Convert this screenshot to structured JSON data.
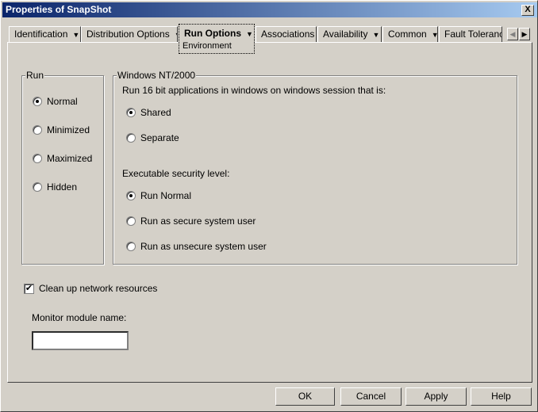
{
  "title": "Properties of SnapShot",
  "close_label": "X",
  "tabs": [
    {
      "label": "Identification",
      "dropdown": true
    },
    {
      "label": "Distribution Options",
      "dropdown": true
    },
    {
      "label": "Run Options",
      "dropdown": true,
      "active": true,
      "sub": "Environment"
    },
    {
      "label": "Associations",
      "dropdown": false
    },
    {
      "label": "Availability",
      "dropdown": true
    },
    {
      "label": "Common",
      "dropdown": true
    },
    {
      "label": "Fault Toleranc",
      "dropdown": false
    }
  ],
  "arrow": "▼",
  "scroll_left": "◀",
  "scroll_right": "▶",
  "run_group": {
    "legend": "Run",
    "options": [
      {
        "label": "Normal",
        "checked": true
      },
      {
        "label": "Minimized",
        "checked": false
      },
      {
        "label": "Maximized",
        "checked": false
      },
      {
        "label": "Hidden",
        "checked": false
      }
    ]
  },
  "nt_group": {
    "legend": "Windows NT/2000",
    "session_label": "Run 16 bit applications in windows on windows session that is:",
    "session_options": [
      {
        "label": "Shared",
        "checked": true
      },
      {
        "label": "Separate",
        "checked": false
      }
    ],
    "security_label": "Executable security level:",
    "security_options": [
      {
        "label": "Run Normal",
        "checked": true
      },
      {
        "label": "Run as secure system user",
        "checked": false
      },
      {
        "label": "Run as unsecure system user",
        "checked": false
      }
    ]
  },
  "cleanup": {
    "label": "Clean up network resources",
    "checked": true,
    "mark": "✔"
  },
  "monitor": {
    "label": "Monitor module name:",
    "value": ""
  },
  "buttons": {
    "ok": "OK",
    "cancel": "Cancel",
    "apply": "Apply",
    "help": "Help"
  }
}
